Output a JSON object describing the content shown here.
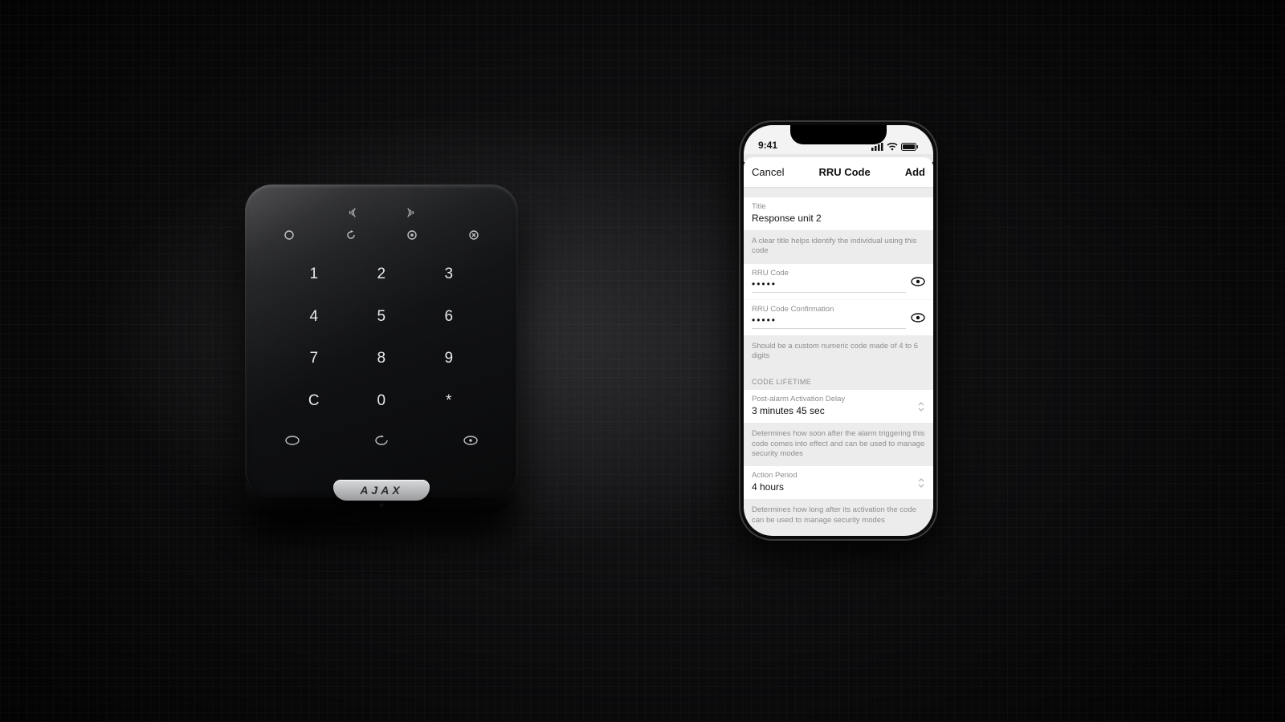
{
  "keypad": {
    "brand": "AJAX",
    "rows": [
      [
        "1",
        "2",
        "3"
      ],
      [
        "4",
        "5",
        "6"
      ],
      [
        "7",
        "8",
        "9"
      ],
      [
        "C",
        "0",
        "*"
      ]
    ]
  },
  "phone": {
    "status": {
      "time": "9:41"
    },
    "navbar": {
      "cancel": "Cancel",
      "title": "RRU Code",
      "add": "Add"
    },
    "title_field": {
      "label": "Title",
      "value": "Response unit 2"
    },
    "title_hint": "A clear title helps identify the individual using this code",
    "code_field": {
      "label": "RRU Code",
      "value": "•••••"
    },
    "code_confirm_field": {
      "label": "RRU Code Confirmation",
      "value": "•••••"
    },
    "code_hint": "Should be a custom numeric code made of 4 to 6 digits",
    "lifetime_header": "CODE LIFETIME",
    "delay_field": {
      "label": "Post-alarm Activation Delay",
      "value": "3 minutes 45 sec"
    },
    "delay_hint": "Determines how soon after the alarm triggering this code comes into effect and can be used to manage security modes",
    "action_field": {
      "label": "Action Period",
      "value": "4 hours"
    },
    "action_hint": "Determines how long after its activation the code can be used to manage security modes"
  }
}
